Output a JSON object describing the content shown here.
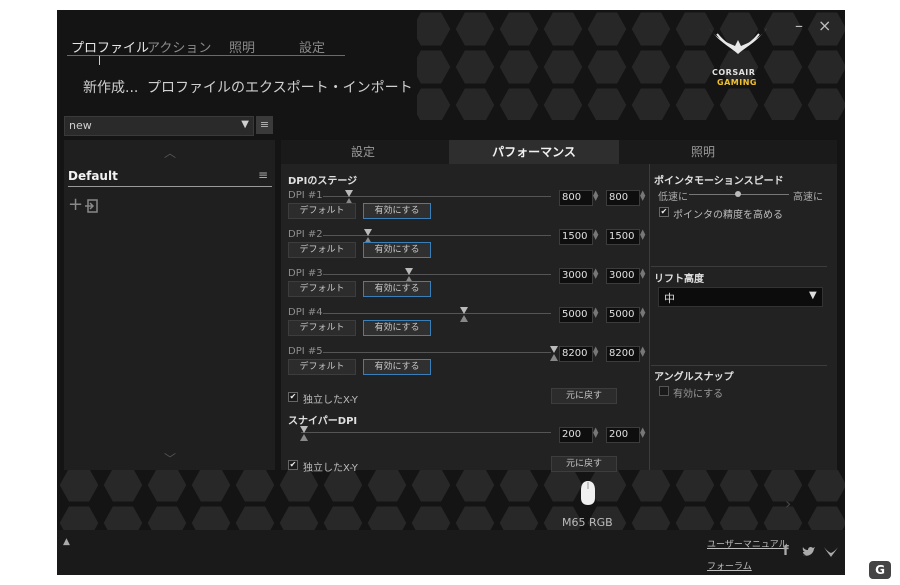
{
  "top_tabs": [
    "プロファイル",
    "アクション",
    "照明",
    "設定"
  ],
  "sub_actions": {
    "new": "新作成...",
    "export": "プロファイルのエクスポート・インポート"
  },
  "window_controls": {
    "minimize": "–",
    "close": "×"
  },
  "logo": {
    "line1": "CORSAIR",
    "line2": "GAMING"
  },
  "profile_select": {
    "value": "new",
    "arrow": "▼",
    "menu": "≡"
  },
  "profile_list": {
    "items": [
      "Default"
    ],
    "menu": "≡",
    "up": "︿",
    "down": "﹀",
    "add": "+"
  },
  "main_tabs": [
    "設定",
    "パフォーマンス",
    "照明"
  ],
  "dpi_section": {
    "header": "DPIのステージ",
    "stages": [
      {
        "label": "DPI #1",
        "x": "800",
        "y": "800",
        "default_label": "デフォルト",
        "enable_label": "有効にする"
      },
      {
        "label": "DPI #2",
        "x": "1500",
        "y": "1500",
        "default_label": "デフォルト",
        "enable_label": "有効にする"
      },
      {
        "label": "DPI #3",
        "x": "3000",
        "y": "3000",
        "default_label": "デフォルト",
        "enable_label": "有効にする"
      },
      {
        "label": "DPI #4",
        "x": "5000",
        "y": "5000",
        "default_label": "デフォルト",
        "enable_label": "有効にする"
      },
      {
        "label": "DPI #5",
        "x": "8200",
        "y": "8200",
        "default_label": "デフォルト",
        "enable_label": "有効にする"
      }
    ],
    "independent_xy": "独立したX-Y",
    "reset_label": "元に戻す"
  },
  "sniper": {
    "header": "スナイパーDPI",
    "x": "200",
    "y": "200",
    "independent_xy": "独立したX-Y",
    "reset_label": "元に戻す"
  },
  "pointer": {
    "header": "ポインタモーションスピード",
    "slow": "低速に",
    "fast": "高速に",
    "precision": "ポインタの精度を高める"
  },
  "lift": {
    "header": "リフト高度",
    "value": "中",
    "arrow": "▼"
  },
  "angle": {
    "header": "アングルスナップ",
    "enable": "有効にする"
  },
  "device": {
    "name": "M65 RGB"
  },
  "footer": {
    "manual": "ユーザーマニュアル",
    "forum": "フォーラム",
    "up_arrow": "▲",
    "social": [
      "f",
      "🐦",
      "ᴡ"
    ]
  },
  "watermark": "G"
}
